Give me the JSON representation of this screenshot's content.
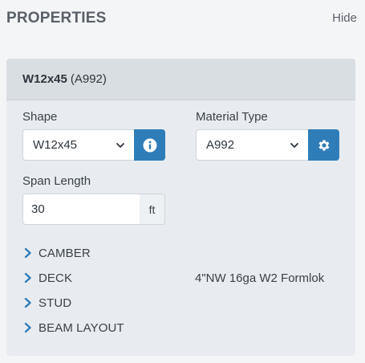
{
  "header": {
    "title": "PROPERTIES",
    "hide_label": "Hide"
  },
  "beam": {
    "name": "W12x45",
    "material_paren": "(A992)"
  },
  "shape": {
    "label": "Shape",
    "value": "W12x45",
    "button_icon": "info-icon"
  },
  "material": {
    "label": "Material Type",
    "value": "A992",
    "button_icon": "gear-icon"
  },
  "span": {
    "label": "Span Length",
    "value": "30",
    "unit": "ft"
  },
  "sections": [
    {
      "label": "CAMBER",
      "value": ""
    },
    {
      "label": "DECK",
      "value": "4\"NW 16ga W2 Formlok"
    },
    {
      "label": "STUD",
      "value": ""
    },
    {
      "label": "BEAM LAYOUT",
      "value": ""
    }
  ],
  "colors": {
    "accent": "#2f7db8",
    "panel_bg": "#e8ecf0",
    "panel_head_bg": "#d9dee3"
  }
}
